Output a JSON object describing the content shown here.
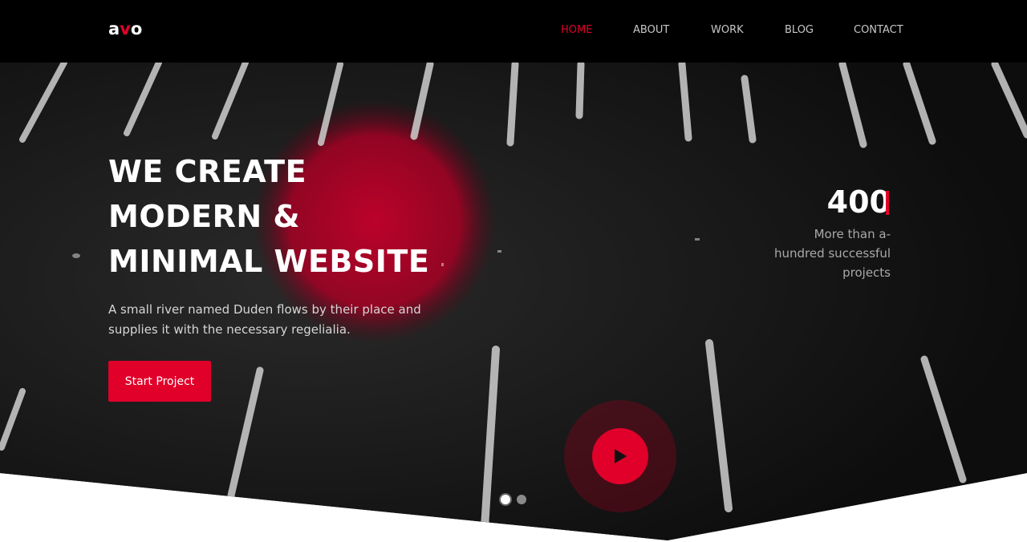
{
  "brand": {
    "logo_prefix": "a",
    "logo_accent": "v",
    "logo_suffix": "o"
  },
  "nav": {
    "items": [
      {
        "label": "HOME",
        "active": true
      },
      {
        "label": "ABOUT",
        "active": false
      },
      {
        "label": "WORK",
        "active": false
      },
      {
        "label": "BLOG",
        "active": false
      },
      {
        "label": "CONTACT",
        "active": false
      }
    ]
  },
  "hero": {
    "headline_lines": [
      "WE CREATE",
      "MODERN &",
      "MINIMAL WEBSITE"
    ],
    "subtext": "A small river named Duden flows by their place and supplies it with the necessary regelialia.",
    "cta_label": "Start Project",
    "stat": {
      "number": "400",
      "caption_lines": [
        "More than a-",
        "hundred successful",
        "projects"
      ]
    },
    "slider": {
      "slide_count": 2,
      "active_index": 0
    }
  },
  "colors": {
    "accent": "#e0002a",
    "navbar_bg": "#000000",
    "hero_bg": "#151515",
    "page_bg": "#ffffff"
  },
  "icons": {
    "play": "play-icon"
  }
}
